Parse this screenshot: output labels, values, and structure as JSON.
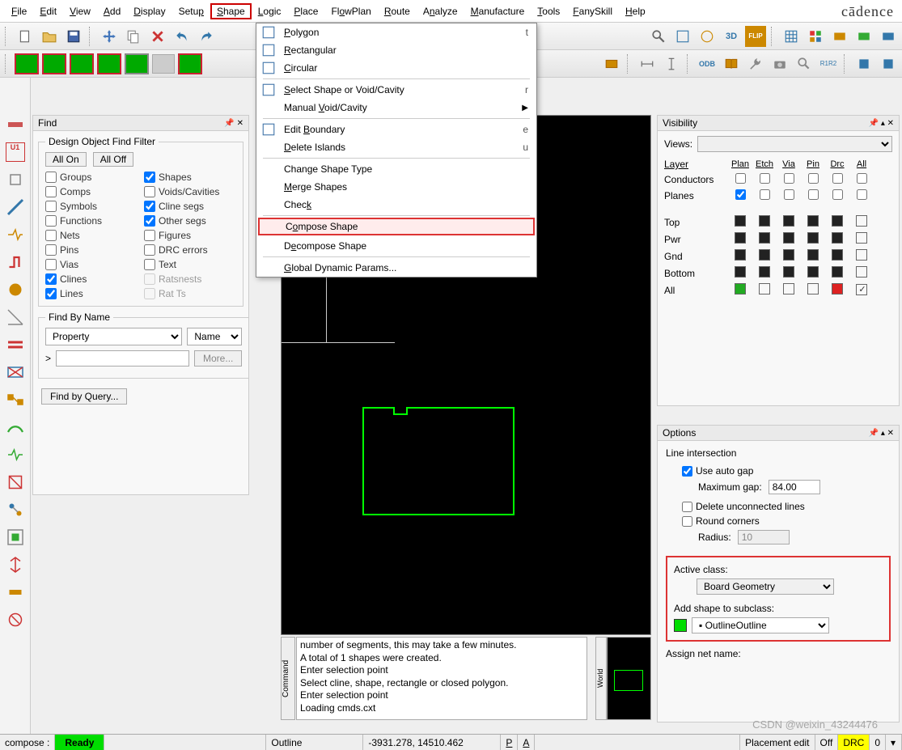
{
  "brand": "cādence",
  "menubar": [
    "File",
    "Edit",
    "View",
    "Add",
    "Display",
    "Setup",
    "Shape",
    "Logic",
    "Place",
    "FlowPlan",
    "Route",
    "Analyze",
    "Manufacture",
    "Tools",
    "FanySkill",
    "Help"
  ],
  "active_menu_index": 6,
  "dropdown": {
    "items": [
      {
        "label": "Polygon",
        "u": "P",
        "shortcut": "t",
        "icon": true
      },
      {
        "label": "Rectangular",
        "u": "R",
        "icon": true
      },
      {
        "label": "Circular",
        "u": "C",
        "icon": true
      },
      {
        "sep": true
      },
      {
        "label": "Select Shape or Void/Cavity",
        "u": "S",
        "shortcut": "r",
        "icon": true
      },
      {
        "label": "Manual Void/Cavity",
        "u": "V",
        "submenu": true
      },
      {
        "sep": true
      },
      {
        "label": "Edit Boundary",
        "u": "B",
        "shortcut": "e",
        "icon": true
      },
      {
        "label": "Delete Islands",
        "u": "D",
        "shortcut": "u"
      },
      {
        "sep": true
      },
      {
        "label": "Change Shape Type"
      },
      {
        "label": "Merge Shapes",
        "u": "M"
      },
      {
        "label": "Check",
        "u": "k"
      },
      {
        "sep": true
      },
      {
        "label": "Compose Shape",
        "u": "o",
        "highlight": true
      },
      {
        "label": "Decompose Shape",
        "u": "e"
      },
      {
        "sep": true
      },
      {
        "label": "Global Dynamic Params...",
        "u": "G"
      }
    ]
  },
  "find": {
    "title": "Find",
    "filter_label": "Design Object Find Filter",
    "all_on": "All On",
    "all_off": "All Off",
    "items": [
      {
        "label": "Groups",
        "checked": false,
        "enabled": true
      },
      {
        "label": "Shapes",
        "checked": true,
        "enabled": true
      },
      {
        "label": "Comps",
        "checked": false,
        "enabled": true
      },
      {
        "label": "Voids/Cavities",
        "checked": false,
        "enabled": true
      },
      {
        "label": "Symbols",
        "checked": false,
        "enabled": true
      },
      {
        "label": "Cline segs",
        "checked": true,
        "enabled": true
      },
      {
        "label": "Functions",
        "checked": false,
        "enabled": true
      },
      {
        "label": "Other segs",
        "checked": true,
        "enabled": true
      },
      {
        "label": "Nets",
        "checked": false,
        "enabled": true
      },
      {
        "label": "Figures",
        "checked": false,
        "enabled": true
      },
      {
        "label": "Pins",
        "checked": false,
        "enabled": true
      },
      {
        "label": "DRC errors",
        "checked": false,
        "enabled": true
      },
      {
        "label": "Vias",
        "checked": false,
        "enabled": true
      },
      {
        "label": "Text",
        "checked": false,
        "enabled": true
      },
      {
        "label": "Clines",
        "checked": true,
        "enabled": true
      },
      {
        "label": "Ratsnests",
        "checked": false,
        "enabled": false
      },
      {
        "label": "Lines",
        "checked": true,
        "enabled": true
      },
      {
        "label": "Rat Ts",
        "checked": false,
        "enabled": false
      }
    ],
    "findby_label": "Find By Name",
    "findby_type": "Property",
    "findby_name": "Name",
    "more": "More...",
    "angle": ">",
    "query": "Find by Query..."
  },
  "visibility": {
    "title": "Visibility",
    "views_lbl": "Views:",
    "layer_lbl": "Layer",
    "cols": [
      "Plan",
      "Etch",
      "Via",
      "Pin",
      "Drc",
      "All"
    ],
    "rows_top": [
      {
        "label": "Conductors",
        "checks": [
          "",
          "",
          "",
          "",
          "",
          ""
        ]
      },
      {
        "label": "Planes",
        "checks": [
          "on",
          "",
          "",
          "",
          "",
          ""
        ]
      }
    ],
    "rows_layers": [
      {
        "label": "Top",
        "boxes": [
          "fill",
          "fill",
          "fill",
          "fill",
          "fill",
          ""
        ]
      },
      {
        "label": "Pwr",
        "boxes": [
          "fill",
          "fill",
          "fill",
          "fill",
          "fill",
          ""
        ]
      },
      {
        "label": "Gnd",
        "boxes": [
          "fill",
          "fill",
          "fill",
          "fill",
          "fill",
          ""
        ]
      },
      {
        "label": "Bottom",
        "boxes": [
          "fill",
          "fill",
          "fill",
          "fill",
          "fill",
          ""
        ]
      },
      {
        "label": "All",
        "boxes": [
          "grn",
          "",
          "",
          "",
          "red",
          "chk"
        ]
      }
    ]
  },
  "options": {
    "title": "Options",
    "line_int": "Line intersection",
    "auto_gap": "Use auto gap",
    "max_gap_lbl": "Maximum gap:",
    "max_gap": "84.00",
    "del_unconn": "Delete unconnected lines",
    "round": "Round corners",
    "radius_lbl": "Radius:",
    "radius": "10",
    "active_class_lbl": "Active class:",
    "active_class": "Board Geometry",
    "add_subclass_lbl": "Add shape to subclass:",
    "subclass": "Outline",
    "assign_net": "Assign net name:"
  },
  "log": [
    "number of segments, this may take a few minutes.",
    "A total of 1 shapes were created.",
    "Enter selection point",
    "Select cline, shape, rectangle or closed polygon.",
    "Enter selection point",
    "Loading cmds.cxt"
  ],
  "log_tab": "Command",
  "world_tab": "World",
  "status": {
    "cmd": "compose :",
    "ready": "Ready",
    "layer": "Outline",
    "coord": "-3931.278, 14510.462",
    "p": "P",
    "a": "A",
    "placement": "Placement edit",
    "off": "Off",
    "drc": "DRC",
    "zero": "0"
  },
  "watermark": "CSDN @weixin_43244476"
}
